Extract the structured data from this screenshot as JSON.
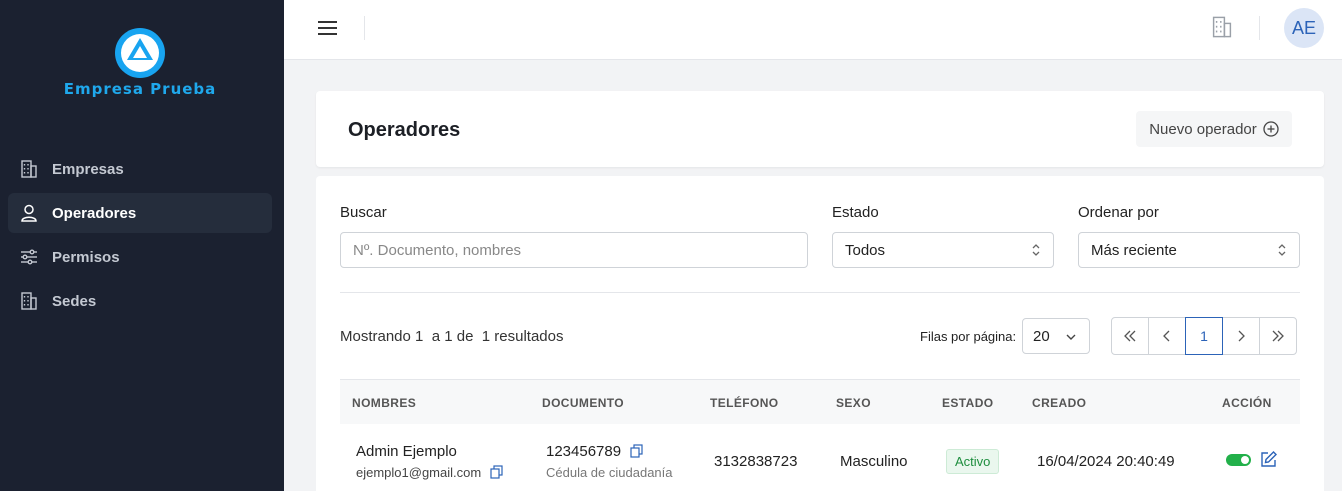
{
  "sidebar": {
    "brand": "Empresa Prueba",
    "items": [
      {
        "label": "Empresas",
        "icon": "building-icon",
        "active": false
      },
      {
        "label": "Operadores",
        "icon": "user-icon",
        "active": true
      },
      {
        "label": "Permisos",
        "icon": "sliders-icon",
        "active": false
      },
      {
        "label": "Sedes",
        "icon": "building-icon",
        "active": false
      }
    ]
  },
  "topbar": {
    "avatar_initials": "AE"
  },
  "page": {
    "title": "Operadores",
    "new_button": "Nuevo operador"
  },
  "filters": {
    "search": {
      "label": "Buscar",
      "placeholder": "Nº. Documento, nombres"
    },
    "status": {
      "label": "Estado",
      "value": "Todos"
    },
    "order": {
      "label": "Ordenar por",
      "value": "Más reciente"
    }
  },
  "results": {
    "showing_text": "Mostrando 1  a 1 de  1 resultados",
    "rows_per_page_label": "Filas por página:",
    "rows_per_page_value": "20",
    "current_page": "1"
  },
  "table": {
    "headers": [
      "NOMBRES",
      "DOCUMENTO",
      "TELÉFONO",
      "SEXO",
      "ESTADO",
      "CREADO",
      "ACCIÓN"
    ],
    "rows": [
      {
        "name": "Admin Ejemplo",
        "email": "ejemplo1@gmail.com",
        "document": "123456789",
        "document_type": "Cédula de ciudadanía",
        "phone": "3132838723",
        "sex": "Masculino",
        "status": "Activo",
        "created": "16/04/2024 20:40:49"
      }
    ]
  },
  "colors": {
    "sidebar_bg": "#1b2130",
    "brand": "#1fa8ec",
    "accent": "#2c63b8",
    "active_green": "#22b04a"
  }
}
